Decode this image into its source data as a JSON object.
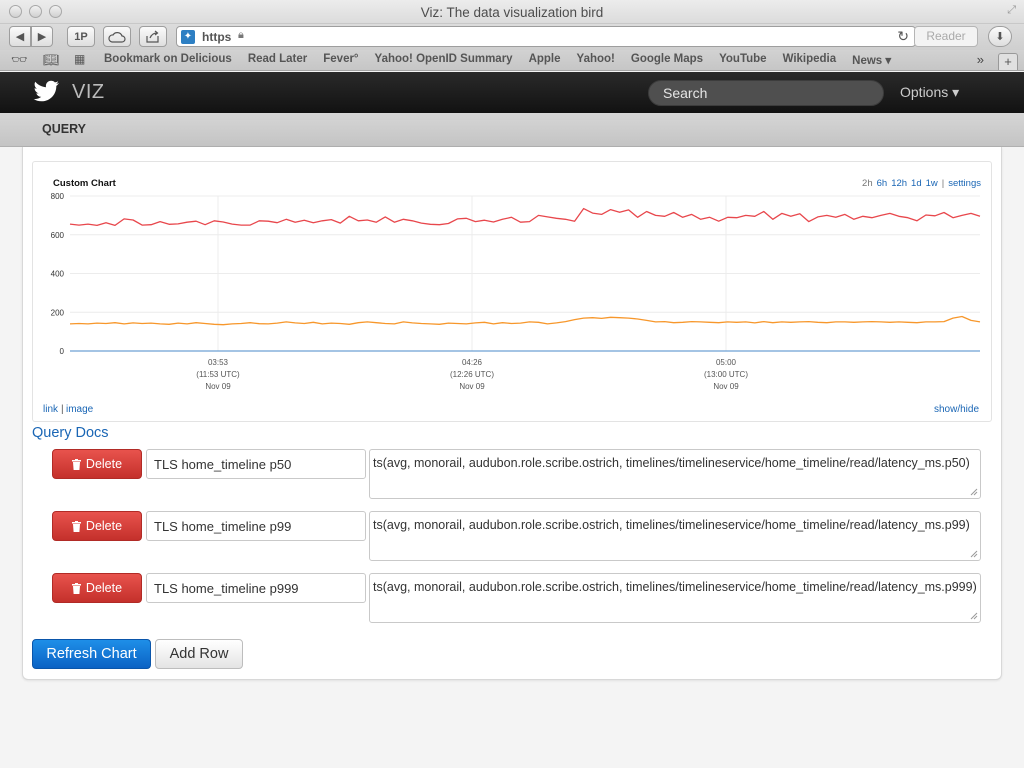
{
  "window": {
    "title": "Viz: The data visualization bird"
  },
  "browser": {
    "onepassword_label": "1P",
    "url_scheme": "https",
    "reader_label": "Reader",
    "bookmarks": [
      "Bookmark on Delicious",
      "Read Later",
      "Fever°",
      "Yahoo! OpenID Summary",
      "Apple",
      "Yahoo!",
      "Google Maps",
      "YouTube",
      "Wikipedia",
      "News ▾"
    ]
  },
  "app": {
    "brand": "VIZ",
    "search_placeholder": "Search",
    "options_label": "Options ▾",
    "subnav_label": "QUERY"
  },
  "chart": {
    "title": "Custom Chart",
    "ranges": [
      "2h",
      "6h",
      "12h",
      "1d",
      "1w"
    ],
    "active_range": "2h",
    "settings_label": "settings",
    "link_label": "link",
    "separator": "|",
    "image_label": "image",
    "showhide_label": "show/hide"
  },
  "chart_data": {
    "type": "line",
    "title": "Custom Chart",
    "ylim": [
      0,
      800
    ],
    "yticks": [
      0,
      200,
      400,
      600,
      800
    ],
    "xticks": [
      {
        "time": "03:53",
        "utc": "(11:53 UTC)",
        "date": "Nov 09"
      },
      {
        "time": "04:26",
        "utc": "(12:26 UTC)",
        "date": "Nov 09"
      },
      {
        "time": "05:00",
        "utc": "(13:00 UTC)",
        "date": "Nov 09"
      }
    ],
    "grid": true,
    "series": [
      {
        "color": "#e8474c",
        "values": [
          655,
          650,
          655,
          648,
          662,
          648,
          682,
          676,
          650,
          652,
          668,
          654,
          656,
          665,
          670,
          652,
          672,
          666,
          655,
          650,
          650,
          672,
          670,
          662,
          680,
          665,
          675,
          662,
          672,
          678,
          660,
          695,
          672,
          676,
          665,
          692,
          665,
          680,
          672,
          660,
          654,
          652,
          658,
          682,
          685,
          668,
          675,
          666,
          680,
          690,
          665,
          668,
          700,
          692,
          685,
          680,
          670,
          735,
          712,
          705,
          730,
          716,
          728,
          690,
          720,
          700,
          695,
          715,
          690,
          705,
          680,
          690,
          670,
          690,
          688,
          700,
          695,
          720,
          680,
          710,
          695,
          708,
          668,
          692,
          700,
          690,
          705,
          680,
          695,
          688,
          700,
          710,
          695,
          688,
          672,
          702,
          698,
          715,
          688,
          700,
          710,
          695
        ]
      },
      {
        "color": "#f7972b",
        "values": [
          140,
          142,
          140,
          144,
          142,
          146,
          140,
          145,
          142,
          144,
          140,
          138,
          144,
          140,
          146,
          142,
          138,
          136,
          140,
          142,
          146,
          141,
          140,
          144,
          150,
          145,
          142,
          148,
          140,
          144,
          142,
          138,
          146,
          150,
          146,
          142,
          140,
          150,
          145,
          142,
          140,
          138,
          144,
          142,
          140,
          145,
          148,
          140,
          146,
          142,
          144,
          150,
          148,
          140,
          145,
          152,
          162,
          170,
          172,
          168,
          174,
          172,
          170,
          165,
          158,
          150,
          152,
          146,
          148,
          152,
          150,
          148,
          146,
          150,
          148,
          150,
          145,
          152,
          146,
          150,
          148,
          150,
          152,
          148,
          146,
          150,
          150,
          148,
          150,
          152,
          150,
          148,
          150,
          148,
          146,
          150,
          150,
          152,
          170,
          178,
          158,
          150
        ]
      },
      {
        "color": "#6ea1d4",
        "values": [
          0,
          0,
          0,
          0,
          0,
          0,
          0,
          0,
          0,
          0,
          0,
          0,
          0,
          0,
          0,
          0,
          0,
          0,
          0,
          0
        ]
      }
    ]
  },
  "docs_label": "Query Docs",
  "rows": [
    {
      "delete_label": "Delete",
      "name": "TLS home_timeline p50",
      "query": "ts(avg, monorail, audubon.role.scribe.ostrich, timelines/timelineservice/home_timeline/read/latency_ms.p50)"
    },
    {
      "delete_label": "Delete",
      "name": "TLS home_timeline p99",
      "query": "ts(avg, monorail, audubon.role.scribe.ostrich, timelines/timelineservice/home_timeline/read/latency_ms.p99)"
    },
    {
      "delete_label": "Delete",
      "name": "TLS home_timeline p999",
      "query": "ts(avg, monorail, audubon.role.scribe.ostrich, timelines/timelineservice/home_timeline/read/latency_ms.p999)"
    }
  ],
  "buttons": {
    "refresh": "Refresh Chart",
    "add_row": "Add Row"
  }
}
